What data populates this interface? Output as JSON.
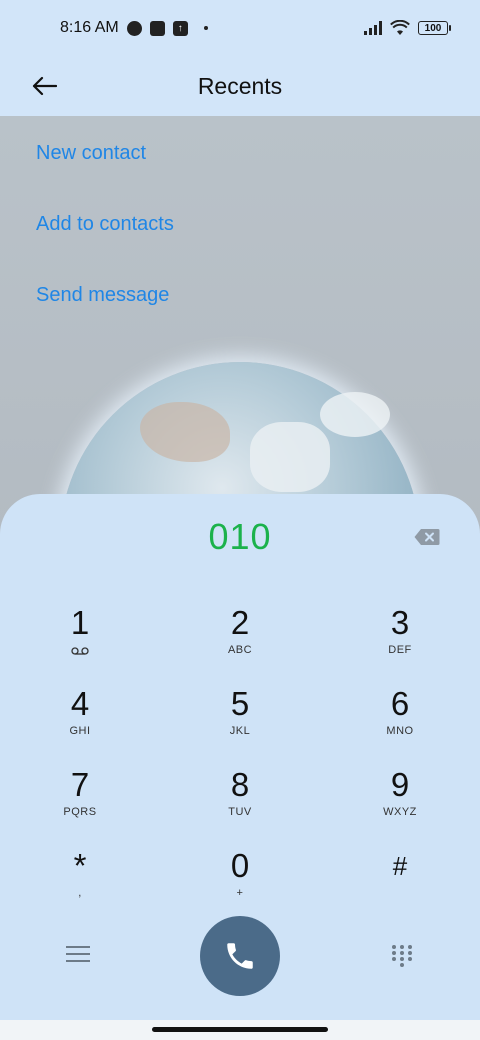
{
  "status_bar": {
    "time": "8:16 AM",
    "battery": "100",
    "icons": [
      "notification-icon",
      "square-icon",
      "upload-icon",
      "dot-icon",
      "signal-icon",
      "wifi-icon",
      "battery-icon"
    ]
  },
  "app_bar": {
    "title": "Recents",
    "back_icon": "arrow-left-icon"
  },
  "actions": [
    {
      "label": "New contact"
    },
    {
      "label": "Add to contacts"
    },
    {
      "label": "Send message"
    }
  ],
  "dialer": {
    "number": "010",
    "number_color": "#1bb24b",
    "keys": [
      {
        "digit": "1",
        "letters": ""
      },
      {
        "digit": "2",
        "letters": "ABC"
      },
      {
        "digit": "3",
        "letters": "DEF"
      },
      {
        "digit": "4",
        "letters": "GHI"
      },
      {
        "digit": "5",
        "letters": "JKL"
      },
      {
        "digit": "6",
        "letters": "MNO"
      },
      {
        "digit": "7",
        "letters": "PQRS"
      },
      {
        "digit": "8",
        "letters": "TUV"
      },
      {
        "digit": "9",
        "letters": "WXYZ"
      },
      {
        "digit": "*",
        "letters": ","
      },
      {
        "digit": "0",
        "letters": "+"
      },
      {
        "digit": "#",
        "letters": ""
      }
    ]
  },
  "colors": {
    "accent_link": "#1f86e6",
    "call_button": "#4b6b89",
    "sheet_background": "#cfe3f7"
  }
}
